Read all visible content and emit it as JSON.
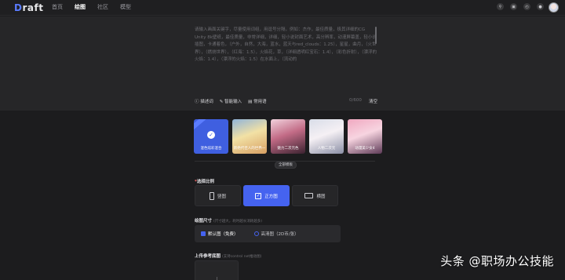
{
  "app": {
    "logo_text": "raft",
    "logo_initial": "D",
    "brand_color": "#5b7cff"
  },
  "nav": {
    "items": [
      "首页",
      "绘图",
      "社区",
      "模型"
    ],
    "active": "绘图"
  },
  "top_icons": [
    "search-icon",
    "chat-icon",
    "history-icon",
    "bell-icon"
  ],
  "prompt": {
    "placeholder": "请输入画面关键字，尽量使用词组，用逗号分隔，例如：杰作，最佳质量，极其详细的CG Unity 8k壁纸，最佳质量，非常详细，详细，轻小说封面艺术，高分辨率，动漫屏幕盖，轻小说插图，卡通着色，（户外，自然，大海，蓝水，蓝天与red_clouds：1.25），星星，曲月，（火世界），（燃烧世界），（红海：1.5），火焰花，草，（详细透明红宝石：1.4），（彩色折射），（漂浮的火焰：1.4），（漂浮的火焰：1.5）在水面上，（流动的",
    "tools": [
      "描述词",
      "智能输入",
      "常用语"
    ],
    "counter": "0/600",
    "clear_label": "清空"
  },
  "styles": {
    "cards": [
      {
        "label": "混色炫彩混合",
        "selected": true
      },
      {
        "label": "新绝代佳人的世界一"
      },
      {
        "label": "魅力二次元色"
      },
      {
        "label": "人物二次元"
      },
      {
        "label": "动漫美少女4"
      }
    ],
    "all_label": "全部模板"
  },
  "ratio": {
    "label": "选择比例",
    "required_mark": "*",
    "options": [
      "竖图",
      "正方图",
      "横图"
    ],
    "active": "正方图"
  },
  "size": {
    "label": "绘图尺寸",
    "hint": "(尺寸越大，耗时越长消耗越多)",
    "options": [
      {
        "label": "默认图（免费）",
        "on": true
      },
      {
        "label": "高清图（2D币/张）",
        "on": false
      }
    ]
  },
  "upload": {
    "label": "上传参考底图",
    "hint": "(支持control net推动图)"
  },
  "watermark": "头条 @职场办公技能"
}
